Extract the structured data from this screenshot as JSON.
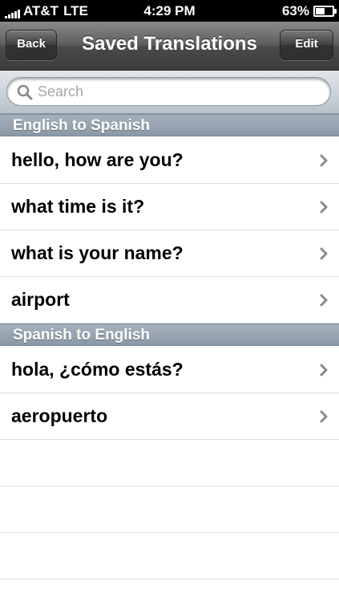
{
  "status_bar": {
    "carrier": "AT&T",
    "network": "LTE",
    "time": "4:29 PM",
    "battery_text": "63%",
    "battery_level": 0.63,
    "signal_bars": 5
  },
  "nav": {
    "back_label": "Back",
    "title": "Saved Translations",
    "edit_label": "Edit"
  },
  "search": {
    "placeholder": "Search",
    "value": ""
  },
  "sections": [
    {
      "title": "English to Spanish",
      "items": [
        {
          "label": "hello, how are you?"
        },
        {
          "label": "what time is it?"
        },
        {
          "label": "what is your name?"
        },
        {
          "label": "airport"
        }
      ]
    },
    {
      "title": "Spanish to English",
      "items": [
        {
          "label": "hola, ¿cómo estás?"
        },
        {
          "label": "aeropuerto"
        }
      ]
    }
  ],
  "icons": {
    "search": "search-icon",
    "row_chevron": "chevron-right-icon",
    "battery": "battery-icon",
    "signal": "signal-icon"
  },
  "colors": {
    "nav_bar": "#4a4a4a",
    "section_header": "#97a4b2",
    "chevron": "#8a8a8a"
  }
}
